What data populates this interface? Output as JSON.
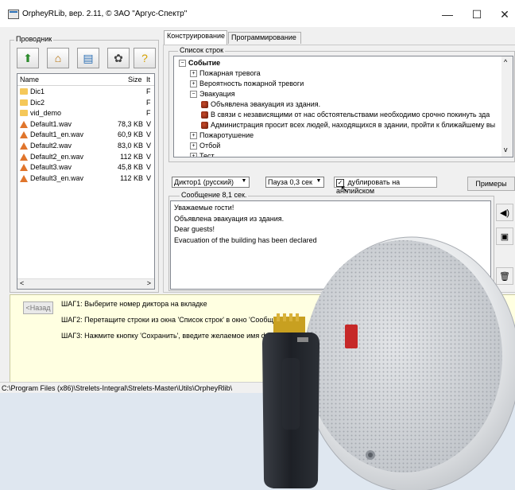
{
  "window": {
    "title": "OrpheyRLib, вер. 2.11, © ЗАО \"Аргус-Спектр\"",
    "minimize": "—",
    "maximize": "☐",
    "close": "✕"
  },
  "explorer": {
    "label": "Проводник",
    "toolbar": [
      {
        "name": "up-folder-icon",
        "glyph": "⬆",
        "color": "#2c8a2c"
      },
      {
        "name": "home-icon",
        "glyph": "⌂",
        "color": "#b36b00"
      },
      {
        "name": "tree-view-icon",
        "glyph": "▤",
        "color": "#2b6fb5"
      },
      {
        "name": "settings-icon",
        "glyph": "✿",
        "color": "#444444"
      },
      {
        "name": "help-icon",
        "glyph": "?",
        "color": "#d4a000"
      }
    ],
    "columns": {
      "name": "Name",
      "size": "Size",
      "type": "It"
    },
    "files": [
      {
        "kind": "folder",
        "name": "Dic1",
        "size": "",
        "type": "F"
      },
      {
        "kind": "folder",
        "name": "Dic2",
        "size": "",
        "type": "F"
      },
      {
        "kind": "folder",
        "name": "vid_demo",
        "size": "",
        "type": "F"
      },
      {
        "kind": "wav",
        "name": "Default1.wav",
        "size": "78,3 KB",
        "type": "V"
      },
      {
        "kind": "wav",
        "name": "Default1_en.wav",
        "size": "60,9 KB",
        "type": "V"
      },
      {
        "kind": "wav",
        "name": "Default2.wav",
        "size": "83,0 KB",
        "type": "V"
      },
      {
        "kind": "wav",
        "name": "Default2_en.wav",
        "size": "112 KB",
        "type": "V"
      },
      {
        "kind": "wav",
        "name": "Default3.wav",
        "size": "45,8 KB",
        "type": "V"
      },
      {
        "kind": "wav",
        "name": "Default3_en.wav",
        "size": "112 KB",
        "type": "V"
      }
    ]
  },
  "tabs": [
    "Конструирование",
    "Программирование"
  ],
  "strings_list": {
    "label": "Список строк",
    "tree": [
      {
        "level": 0,
        "toggle": "−",
        "text": "Событие",
        "bold": true
      },
      {
        "level": 1,
        "toggle": "+",
        "text": "Пожарная тревога"
      },
      {
        "level": 1,
        "toggle": "+",
        "text": "Вероятность пожарной тревоги"
      },
      {
        "level": 1,
        "toggle": "−",
        "text": "Эвакуация"
      },
      {
        "level": 2,
        "toggle": "",
        "text": "Объявлена эвакуация из здания.",
        "speaker": true
      },
      {
        "level": 2,
        "toggle": "",
        "text": "В связи с независящими от нас обстоятельствами необходимо срочно покинуть зда",
        "speaker": true
      },
      {
        "level": 2,
        "toggle": "",
        "text": "Администрация просит всех людей, находящихся в здании, пройти к ближайшему вы",
        "speaker": true
      },
      {
        "level": 1,
        "toggle": "+",
        "text": "Пожаротушение"
      },
      {
        "level": 1,
        "toggle": "+",
        "text": "Отбой"
      },
      {
        "level": 1,
        "toggle": "+",
        "text": "Тест"
      }
    ]
  },
  "controls": {
    "announcer": "Диктор1 (русский)",
    "pause": "Пауза 0,3 сек",
    "duplicate_label": "дублировать на английском",
    "duplicate_checked": true,
    "examples": "Примеры"
  },
  "message": {
    "label": "Сообщение 8,1 сек.",
    "lines": [
      "Уважаемые гости!",
      "Объявлена эвакуация из здания.",
      "Dear guests!",
      "Evacuation of the building has been declared"
    ]
  },
  "side_buttons": [
    {
      "name": "play-icon",
      "glyph": "◀)"
    },
    {
      "name": "save-icon",
      "glyph": "▣"
    },
    {
      "name": "delete-icon",
      "glyph": "🗑"
    }
  ],
  "steps": {
    "back": "<Назад",
    "lines": [
      "ШАГ1: Выберите номер диктора на вкладке",
      "ШАГ2: Перетащите строки из окна 'Список строк' в окно 'Сообщение'",
      "ШАГ3: Нажмите кнопку 'Сохранить', введите желаемое имя фа"
    ]
  },
  "status_path": "C:\\Program Files (x86)\\Strelets-Integral\\Strelets-Master\\Utils\\OrpheyRlib\\"
}
